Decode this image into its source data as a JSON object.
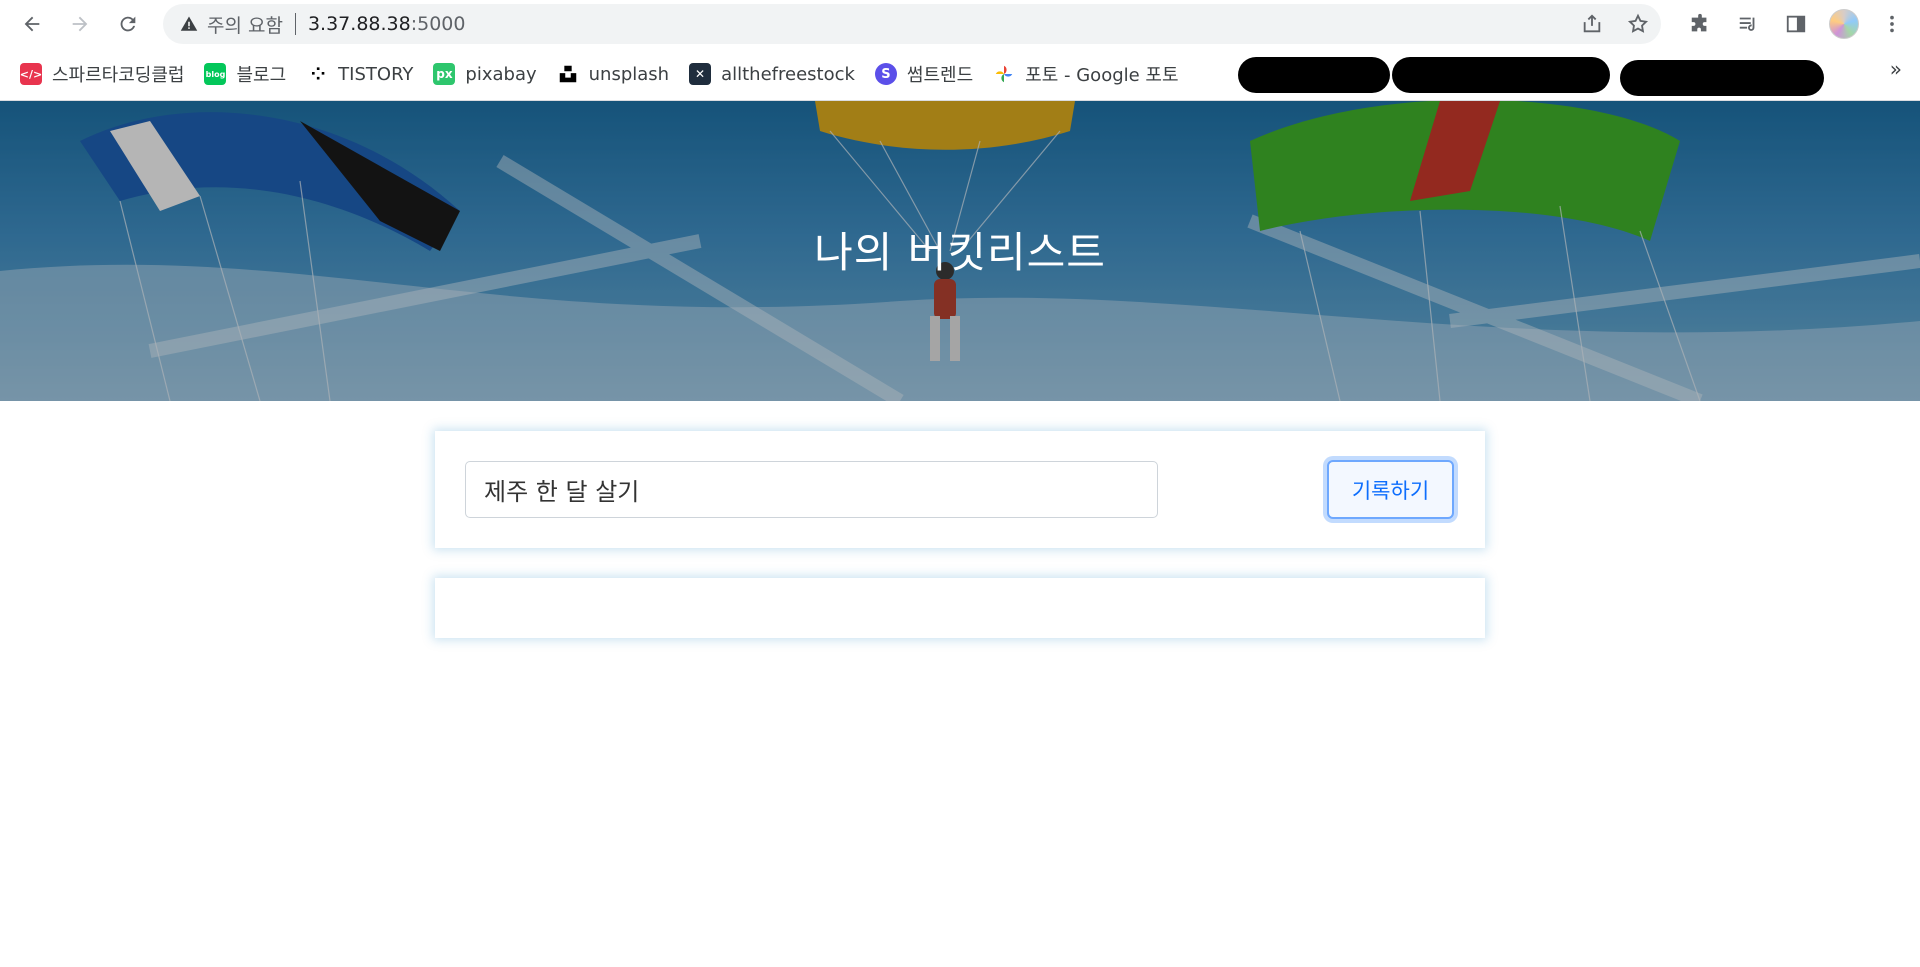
{
  "browser": {
    "security_warning": "주의 요함",
    "url_host": "3.37.88.38",
    "url_port": ":5000"
  },
  "bookmarks": [
    {
      "label": "스파르타코딩클럽",
      "icon": "spartacoding-icon",
      "color": "#e8344e"
    },
    {
      "label": "블로그",
      "icon": "naver-blog-icon",
      "color": "#03c75a"
    },
    {
      "label": "TISTORY",
      "icon": "tistory-icon",
      "color": "#000000"
    },
    {
      "label": "pixabay",
      "icon": "pixabay-icon",
      "color": "#2ec66d"
    },
    {
      "label": "unsplash",
      "icon": "unsplash-icon",
      "color": "#000000"
    },
    {
      "label": "allthefreestock",
      "icon": "allthefreestock-icon",
      "color": "#1f2d3d"
    },
    {
      "label": "썸트렌드",
      "icon": "sometrend-icon",
      "color": "#5b4fe9"
    },
    {
      "label": "포토 - Google 포토",
      "icon": "google-photos-icon",
      "color": "#4285f4"
    }
  ],
  "page": {
    "title": "나의 버킷리스트",
    "input_value": "제주 한 달 살기",
    "submit_label": "기록하기"
  }
}
